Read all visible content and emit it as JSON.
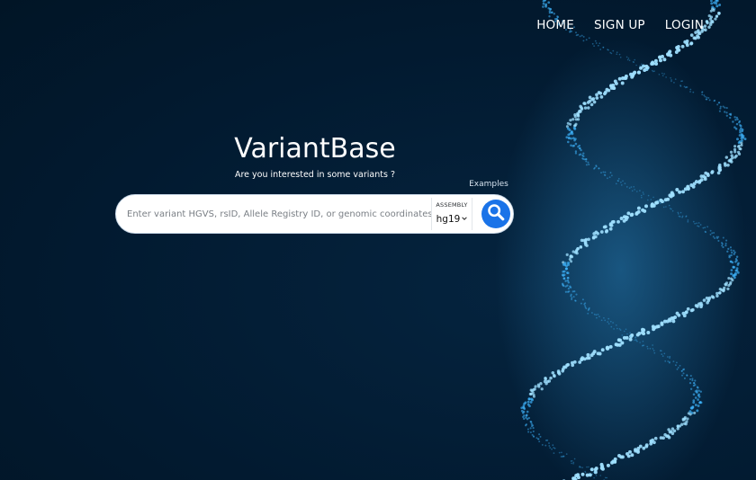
{
  "nav": {
    "items": [
      {
        "label": "HOME"
      },
      {
        "label": "SIGN UP"
      },
      {
        "label": "LOGIN"
      }
    ]
  },
  "hero": {
    "title": "VariantBase",
    "subtitle": "Are you interested in some variants ?",
    "examples_link": "Examples"
  },
  "search": {
    "placeholder": "Enter variant HGVS, rsID, Allele Registry ID, or genomic coordinates.",
    "value": "",
    "assembly_label": "ASSEMBLY",
    "assembly_selected": "hg19"
  },
  "icons": {
    "search_button": "search-icon",
    "assembly_dropdown": "chevron-down-icon"
  },
  "colors": {
    "background": "#021a30",
    "accent": "#1a73e8",
    "dna_glow": "#3fb6ff"
  }
}
